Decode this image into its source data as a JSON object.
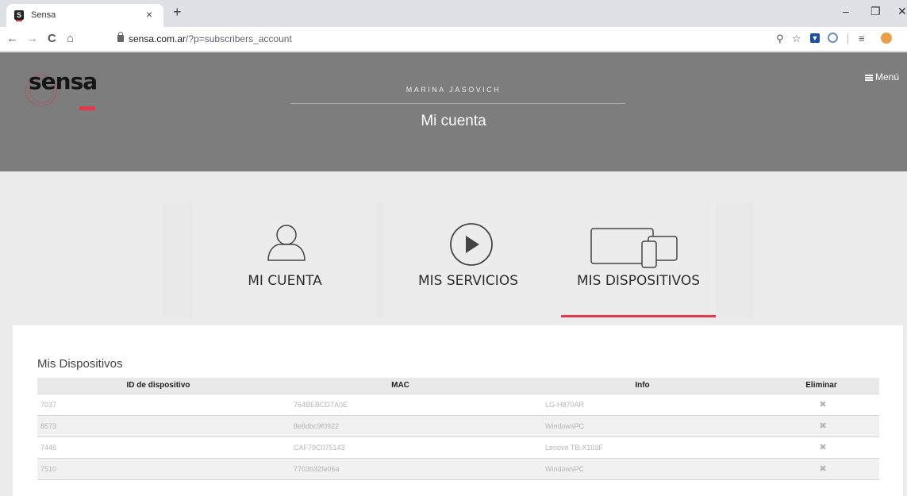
{
  "browser": {
    "tab_title": "Sensa",
    "tab_favicon": "S",
    "tab_close": "×",
    "new_tab": "+",
    "minimize": "–",
    "restore": "❐",
    "close": "✕",
    "back": "←",
    "forward": "→",
    "reload": "C",
    "home": "⌂",
    "url_host": "sensa.com.ar",
    "url_path": "/?p=subscribers_account",
    "zoom_icon": "⚲",
    "star_icon": "☆",
    "media_icon": "≡"
  },
  "header": {
    "logo": "sensa",
    "menu_label": "Menú",
    "username": "MARINA JASOVICH",
    "page_title": "Mi cuenta"
  },
  "cards": [
    {
      "label": "MI CUENTA",
      "icon": "user-icon"
    },
    {
      "label": "MIS SERVICIOS",
      "icon": "play-icon"
    },
    {
      "label": "MIS DISPOSITIVOS",
      "icon": "devices-icon"
    }
  ],
  "devices": {
    "title": "Mis Dispositivos",
    "columns": [
      "ID de dispositivo",
      "MAC",
      "Info",
      "Eliminar"
    ],
    "rows": [
      {
        "id": "7037",
        "mac": "764BEBCD7A0E",
        "info": "LG-H870AR",
        "delete": "✖"
      },
      {
        "id": "8573",
        "mac": "8e8dbc9f0922",
        "info": "WindowsPC",
        "delete": "✖"
      },
      {
        "id": "7446",
        "mac": "CAF79C075143",
        "info": "Lenovo TB-X103F",
        "delete": "✖"
      },
      {
        "id": "7510",
        "mac": "7703b32fe06a",
        "info": "WindowsPC",
        "delete": "✖"
      }
    ]
  },
  "colors": {
    "accent": "#e0394b",
    "hero_bg": "#7d7d7d",
    "delete": "#6e2f5a"
  }
}
